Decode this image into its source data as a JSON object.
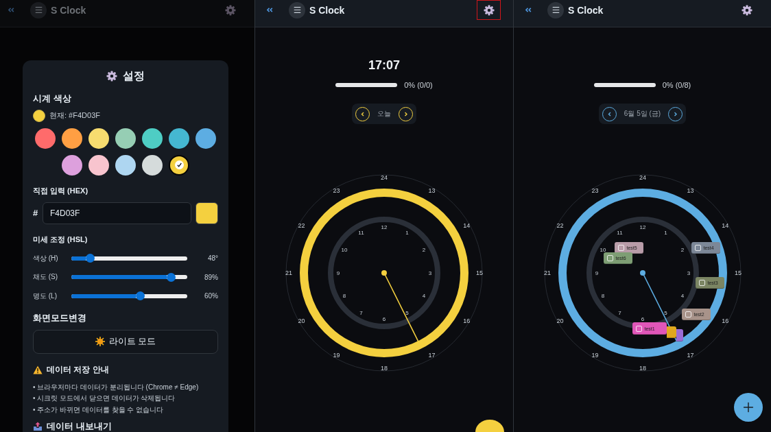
{
  "panels": [
    {
      "kind": "settings",
      "header": {
        "title": "S Clock",
        "dimmed": true,
        "highlighted": false
      },
      "settings": {
        "title": "설정",
        "color_section": {
          "heading": "시계 색상",
          "current": "현재: #F4D03F",
          "swatches": [
            {
              "color": "#FF6B6B",
              "selected": false
            },
            {
              "color": "#FF9F43",
              "selected": false
            },
            {
              "color": "#F7DC6F",
              "selected": false
            },
            {
              "color": "#96CEB4",
              "selected": false
            },
            {
              "color": "#4ECDC4",
              "selected": false
            },
            {
              "color": "#45B7D1",
              "selected": false
            },
            {
              "color": "#5DADE2",
              "selected": false
            },
            {
              "color": "#DDA0DD",
              "selected": false
            },
            {
              "color": "#F8C4CE",
              "selected": false
            },
            {
              "color": "#AED6F1",
              "selected": false
            },
            {
              "color": "#D5DBDB",
              "selected": false
            },
            {
              "color": "#F4D03F",
              "selected": true
            }
          ]
        },
        "hex_section": {
          "heading": "직접 입력 (HEX)",
          "prefix": "#",
          "value": "F4D03F"
        },
        "hsl_section": {
          "heading": "미세 조정 (HSL)",
          "sliders": [
            {
              "label": "색상 (H)",
              "level": 0.133,
              "reading": "48°"
            },
            {
              "label": "채도 (S)",
              "level": 0.89,
              "reading": "89%"
            },
            {
              "label": "명도 (L)",
              "level": 0.6,
              "reading": "60%"
            }
          ]
        },
        "mode_section": {
          "heading": "화면모드변경",
          "button": "라이트 모드"
        },
        "notice": {
          "heading": "데이터 저장 안내",
          "items": [
            "• 브라우저마다 데이터가 분리됩니다 (Chrome ≠ Edge)",
            "• 시크릿 모드에서 닫으면 데이터가 삭제됩니다",
            "• 주소가 바뀌면 데이터를 찾을 수 없습니다"
          ]
        },
        "export": {
          "heading": "데이터 내보내기"
        }
      }
    },
    {
      "kind": "clock",
      "color": "#F4D03F",
      "header": {
        "title": "S Clock",
        "dimmed": false,
        "highlighted": true
      },
      "time": "17:07",
      "progress": {
        "level": 0,
        "label": "0% (0/0)"
      },
      "date_nav": {
        "label": "오늘"
      },
      "clock": {
        "outer_labels": [
          "24",
          "13",
          "14",
          "15",
          "16",
          "17",
          "18",
          "19",
          "20",
          "21",
          "22",
          "23"
        ],
        "inner_labels": [
          "12",
          "1",
          "2",
          "3",
          "4",
          "5",
          "6",
          "7",
          "8",
          "9",
          "10",
          "11"
        ]
      }
    },
    {
      "kind": "clock",
      "color": "#5DADE2",
      "header": {
        "title": "S Clock",
        "dimmed": false,
        "highlighted": false
      },
      "progress": {
        "level": 0,
        "label": "0% (0/8)"
      },
      "date_nav": {
        "label": "6월 5일 (금)"
      },
      "clock": {
        "outer_labels": [
          "24",
          "13",
          "14",
          "15",
          "16",
          "17",
          "18",
          "19",
          "20",
          "21",
          "22",
          "23"
        ],
        "inner_labels": [
          "12",
          "1",
          "2",
          "3",
          "4",
          "5",
          "6",
          "7",
          "8",
          "9",
          "10",
          "11"
        ],
        "tasks": [
          {
            "label": "test1",
            "color": "#E056B8",
            "checked": false
          },
          {
            "label": "test2",
            "color": "#A8938A",
            "checked": false
          },
          {
            "label": "test3",
            "color": "#7B8563",
            "checked": false
          },
          {
            "label": "test4",
            "color": "#7C8797",
            "checked": false
          },
          {
            "label": "test5",
            "color": "#B89CA8",
            "checked": false
          },
          {
            "label": "test6",
            "color": "#7E9E74",
            "checked": false
          },
          {
            "color": "#E0A81E"
          },
          {
            "color": "#9B6DD6"
          }
        ]
      }
    }
  ]
}
